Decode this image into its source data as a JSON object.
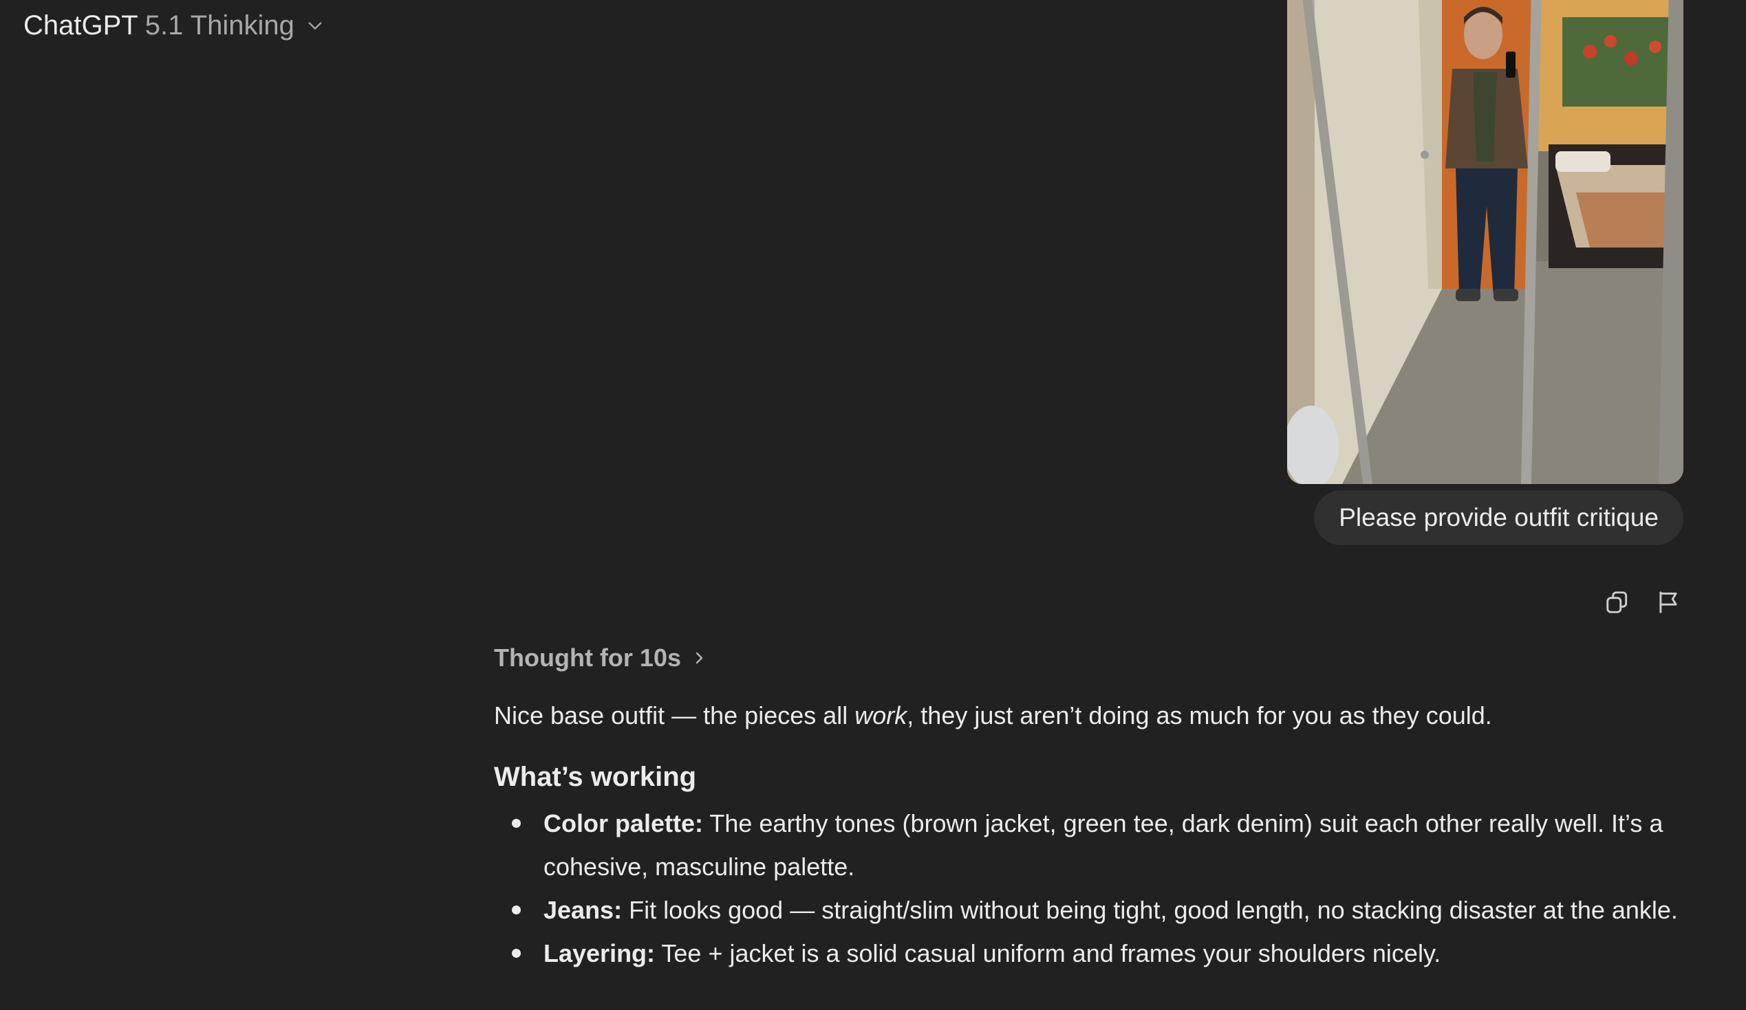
{
  "header": {
    "model_name": "ChatGPT",
    "model_version": "5.1 Thinking"
  },
  "user_message": {
    "text": "Please provide outfit critique",
    "image_alt": "Mirror selfie photo",
    "actions": {
      "copy_icon": "copy-icon",
      "flag_icon": "flag-icon"
    }
  },
  "assistant": {
    "thought_label": "Thought for 10s",
    "intro": {
      "before": "Nice base outfit — the pieces all ",
      "emphasis": "work",
      "after": ", they just aren’t doing as much for you as they could."
    },
    "section_heading": "What’s working",
    "bullets": [
      {
        "label": "Color palette:",
        "text": " The earthy tones (brown jacket, green tee, dark denim) suit each other really well. It’s a",
        "continuation": "cohesive, masculine palette."
      },
      {
        "label": "Jeans:",
        "text": " Fit looks good — straight/slim without being tight, good length, no stacking disaster at the ankle."
      },
      {
        "label": "Layering:",
        "text": " Tee + jacket is a solid casual uniform and frames your shoulders nicely."
      }
    ]
  },
  "colors": {
    "background": "#212121",
    "bubble": "#303030",
    "text": "#ececec",
    "muted": "#b4b4b4"
  }
}
